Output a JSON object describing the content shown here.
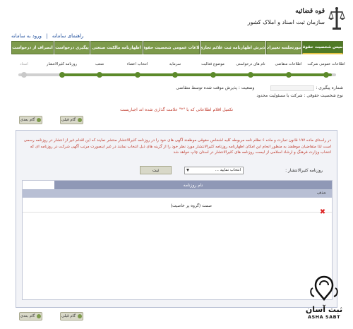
{
  "header": {
    "org_line1": "قوه قضائیه",
    "org_line2": "سازمان ثبت اسناد و املاک کشور",
    "links": [
      "راهنمای سامانه",
      "ورود به سامانه"
    ]
  },
  "nav": {
    "tabs": [
      {
        "label": "تأسیس شخصیت حقوقی",
        "active": true
      },
      {
        "label": "صورتجلسه تغییرات",
        "active": false
      },
      {
        "label": "پذیرش اظهارنامه ثبت علائم تجاری",
        "active": false
      },
      {
        "label": "اطلاعات عمومی شخصیت حقوقی",
        "active": false
      },
      {
        "label": "اظهارنامه مالکیت صنعتی",
        "active": false
      },
      {
        "label": "پیگیری درخواست",
        "active": false
      },
      {
        "label": "انصراف از درخواست",
        "active": false
      }
    ]
  },
  "steps": {
    "items": [
      {
        "label": "اطلاعات عمومی شرکت",
        "done": true
      },
      {
        "label": "اطلاعات متقاضی",
        "done": true
      },
      {
        "label": "نام های درخواستی",
        "done": true
      },
      {
        "label": "موضوع فعالیت",
        "done": true
      },
      {
        "label": "سرمایه",
        "done": true
      },
      {
        "label": "انتخاب اعضاء",
        "done": true
      },
      {
        "label": "شعب",
        "done": true
      },
      {
        "label": "روزنامه کثیرالانتشار",
        "done": true
      },
      {
        "label": "اسناد",
        "done": false
      }
    ]
  },
  "info": {
    "tracking_label": "شماره پیگیری :",
    "status_label": "وضعیت :",
    "status_value": "پذیرش موقت شده توسط متقاضی",
    "entity_type": "نوع شخصیت حقوقی : شرکت با مسئولیت محدود",
    "required_note": "تکمیل اقلام اطلاعاتی که با \"*\" علامت گذاری شده اند اجباریست"
  },
  "buttons": {
    "prev": "گام قبلی",
    "next": "گام بعدی",
    "search": "ثبت"
  },
  "panel": {
    "description": "در راستای ماده ۱۹۷ قانون تجارت و ماده ۶ نظام نامه مربوطه کلیه اشخاص حقوقی موظفند آگهی های خود را در روزنامه کثیرالانتشار منتشر نمایند که این اقدام غیر از انتشار در روزنامه رسمی است لذا متقاضیان موظفند به منظور انجام این امکان اظهارنامه روزنامه کثیرالانتشار مورد نظر خود را از گزینه های ذیل انتخاب نمایند در غیر اینصورت مرتب آگهی شرکت در روزنامه ای که انتخاب وزارت فرهنگ و ارشاد اسلامی از لیست روزنامه های کثیرالانتشار در استان چاپ خواهد شد",
    "paper_label": "روزنامه کثیرالانتشار :",
    "select_value": "انتخاب نمایید ...",
    "grid_header": "نام روزنامه",
    "delete_col": "حذف",
    "rows": [
      "صمت (گروه پر خاصیت)"
    ]
  },
  "watermark": {
    "title": "ثبت آسان",
    "subtitle": "ASHA SABT"
  }
}
